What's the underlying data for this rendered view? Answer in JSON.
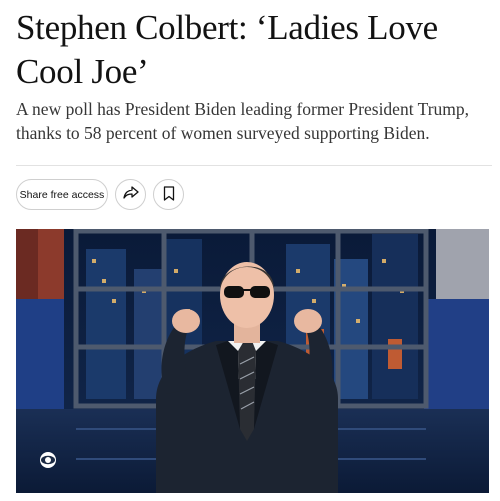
{
  "article": {
    "headline": "Stephen Colbert: ‘Ladies Love Cool Joe’",
    "summary": "A new poll has President Biden leading former President Trump, thanks to 58 percent of women surveyed supporting Biden."
  },
  "actions": {
    "share_free_access_label": "Share free access",
    "share_icon": "share-arrow-icon",
    "save_icon": "bookmark-icon"
  },
  "media": {
    "image_subject": "Host in dark suit and sunglasses gesturing on late-night show set",
    "watermark_icon": "cbs-eye-logo"
  },
  "colors": {
    "text_primary": "#121212",
    "text_secondary": "#363636",
    "border": "#cfcfcf"
  }
}
